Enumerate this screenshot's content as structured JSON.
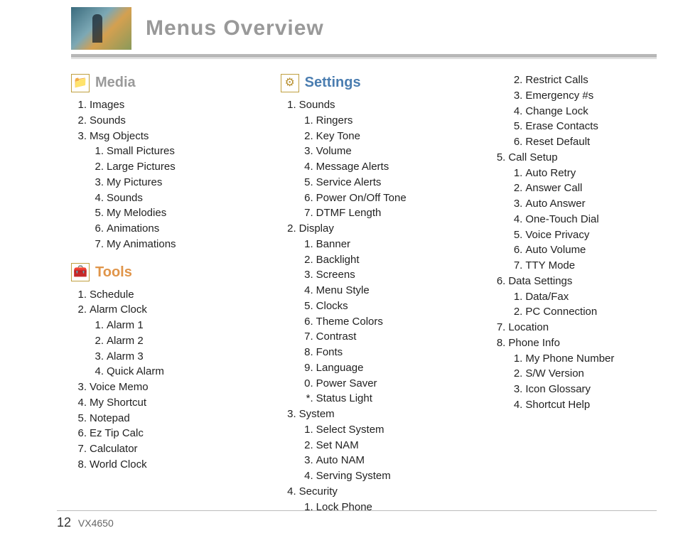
{
  "page_title": "Menus Overview",
  "page_number": "12",
  "model": "VX4650",
  "sections": {
    "media": {
      "title": "Media",
      "icon": "📁",
      "items": [
        {
          "n": "1.",
          "t": "Images"
        },
        {
          "n": "2.",
          "t": "Sounds"
        },
        {
          "n": "3.",
          "t": "Msg Objects",
          "sub": [
            {
              "n": "1.",
              "t": "Small Pictures"
            },
            {
              "n": "2.",
              "t": "Large Pictures"
            },
            {
              "n": "3.",
              "t": "My Pictures"
            },
            {
              "n": "4.",
              "t": "Sounds"
            },
            {
              "n": "5.",
              "t": "My Melodies"
            },
            {
              "n": "6.",
              "t": "Animations"
            },
            {
              "n": "7.",
              "t": "My Animations"
            }
          ]
        }
      ]
    },
    "tools": {
      "title": "Tools",
      "icon": "🧰",
      "items": [
        {
          "n": "1.",
          "t": "Schedule"
        },
        {
          "n": "2.",
          "t": "Alarm Clock",
          "sub": [
            {
              "n": "1.",
              "t": "Alarm 1"
            },
            {
              "n": "2.",
              "t": "Alarm 2"
            },
            {
              "n": "3.",
              "t": "Alarm 3"
            },
            {
              "n": "4.",
              "t": "Quick Alarm"
            }
          ]
        },
        {
          "n": "3.",
          "t": "Voice Memo"
        },
        {
          "n": "4.",
          "t": "My Shortcut"
        },
        {
          "n": "5.",
          "t": "Notepad"
        },
        {
          "n": "6.",
          "t": "Ez Tip Calc"
        },
        {
          "n": "7.",
          "t": "Calculator"
        },
        {
          "n": "8.",
          "t": "World Clock"
        }
      ]
    },
    "settings": {
      "title": "Settings",
      "icon": "⚙",
      "col2_items": [
        {
          "n": "1.",
          "t": "Sounds",
          "sub": [
            {
              "n": "1.",
              "t": "Ringers"
            },
            {
              "n": "2.",
              "t": "Key Tone"
            },
            {
              "n": "3.",
              "t": "Volume"
            },
            {
              "n": "4.",
              "t": "Message Alerts"
            },
            {
              "n": "5.",
              "t": "Service Alerts"
            },
            {
              "n": "6.",
              "t": "Power On/Off Tone"
            },
            {
              "n": "7.",
              "t": "DTMF Length"
            }
          ]
        },
        {
          "n": "2.",
          "t": "Display",
          "sub": [
            {
              "n": "1.",
              "t": "Banner"
            },
            {
              "n": "2.",
              "t": "Backlight"
            },
            {
              "n": "3.",
              "t": "Screens"
            },
            {
              "n": "4.",
              "t": "Menu Style"
            },
            {
              "n": "5.",
              "t": "Clocks"
            },
            {
              "n": "6.",
              "t": "Theme Colors"
            },
            {
              "n": "7.",
              "t": "Contrast"
            },
            {
              "n": "8.",
              "t": "Fonts"
            },
            {
              "n": "9.",
              "t": "Language"
            },
            {
              "n": "0.",
              "t": "Power Saver"
            },
            {
              "n": "*.",
              "t": "Status Light"
            }
          ]
        },
        {
          "n": "3.",
          "t": "System",
          "sub": [
            {
              "n": "1.",
              "t": "Select System"
            },
            {
              "n": "2.",
              "t": "Set NAM"
            },
            {
              "n": "3.",
              "t": "Auto NAM"
            },
            {
              "n": "4.",
              "t": "Serving System"
            }
          ]
        },
        {
          "n": "4.",
          "t": "Security",
          "sub": [
            {
              "n": "1.",
              "t": "Lock Phone"
            }
          ]
        }
      ],
      "col3_items": [
        {
          "n": "",
          "t": "",
          "sub": [
            {
              "n": "2.",
              "t": "Restrict Calls"
            },
            {
              "n": "3.",
              "t": "Emergency #s"
            },
            {
              "n": "4.",
              "t": "Change Lock"
            },
            {
              "n": "5.",
              "t": "Erase Contacts"
            },
            {
              "n": "6.",
              "t": "Reset Default"
            }
          ]
        },
        {
          "n": "5.",
          "t": "Call Setup",
          "sub": [
            {
              "n": "1.",
              "t": "Auto Retry"
            },
            {
              "n": "2.",
              "t": "Answer Call"
            },
            {
              "n": "3.",
              "t": "Auto Answer"
            },
            {
              "n": "4.",
              "t": "One-Touch Dial"
            },
            {
              "n": "5.",
              "t": "Voice Privacy"
            },
            {
              "n": "6.",
              "t": "Auto Volume"
            },
            {
              "n": "7.",
              "t": "TTY Mode"
            }
          ]
        },
        {
          "n": "6.",
          "t": "Data Settings",
          "sub": [
            {
              "n": "1.",
              "t": "Data/Fax"
            },
            {
              "n": "2.",
              "t": "PC Connection"
            }
          ]
        },
        {
          "n": "7.",
          "t": "Location"
        },
        {
          "n": "8.",
          "t": "Phone Info",
          "sub": [
            {
              "n": "1.",
              "t": "My Phone Number"
            },
            {
              "n": "2.",
              "t": "S/W Version"
            },
            {
              "n": "3.",
              "t": "Icon Glossary"
            },
            {
              "n": "4.",
              "t": "Shortcut Help"
            }
          ]
        }
      ]
    }
  }
}
